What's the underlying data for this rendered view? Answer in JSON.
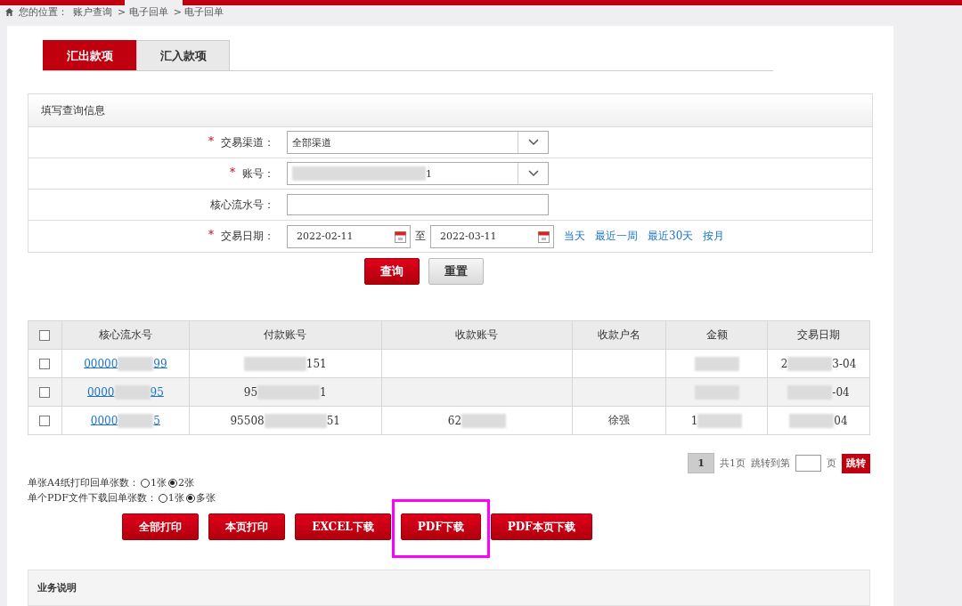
{
  "breadcrumb": {
    "label": "您的位置：",
    "path": [
      "账户查询",
      "> 电子回单",
      "> 电子回单"
    ]
  },
  "tabs": [
    {
      "label": "汇出款项",
      "selected": true
    },
    {
      "label": "汇入款项",
      "selected": false
    }
  ],
  "form": {
    "title": "填写查询信息",
    "fields": [
      {
        "kind": "select",
        "label": "交易渠道：",
        "marker": "*",
        "redacted": false,
        "value": "全部渠道"
      },
      {
        "kind": "select",
        "label": "账号：",
        "marker": "*",
        "redacted": true,
        "value": "1"
      },
      {
        "kind": "text",
        "label": "核心流水号："
      },
      {
        "kind": "daterange",
        "label": "交易日期：",
        "marker": "*",
        "from": "2022-02-11",
        "to_label": "至",
        "to": "2022-03-11",
        "shortcuts": [
          "当天",
          "最近一周",
          "最近30天",
          "按月"
        ]
      }
    ],
    "buttons": [
      {
        "label": "查询",
        "primary": true
      },
      {
        "label": "重置",
        "primary": false
      }
    ]
  },
  "table": {
    "header_checked": false,
    "columns": [
      "核心流水号",
      "付款账号",
      "收款账号",
      "收款户名",
      "金额",
      "交易日期"
    ],
    "rows": [
      {
        "checked": false,
        "cells": [
          {
            "before": "00000",
            "after": "99",
            "redacted": true
          },
          {
            "after": "151",
            "redacted": true
          },
          {
            "redacted": false
          },
          {
            "redacted": false
          },
          {
            "redacted": true
          },
          {
            "before": "2",
            "after": "3-04",
            "redacted": true
          }
        ]
      },
      {
        "checked": false,
        "cells": [
          {
            "before": "0000",
            "after": "95",
            "redacted": true
          },
          {
            "before": "95",
            "after": "1",
            "redacted": true
          },
          {
            "redacted": false
          },
          {
            "redacted": false
          },
          {
            "redacted": true
          },
          {
            "after": "-04",
            "redacted": true
          }
        ]
      },
      {
        "checked": false,
        "cells": [
          {
            "before": "0000",
            "after": "5",
            "redacted": true
          },
          {
            "before": "95508",
            "after": "51",
            "redacted": true
          },
          {
            "before": "62",
            "redacted": true
          },
          {
            "before": "徐强",
            "redacted": false
          },
          {
            "before": "1",
            "redacted": true
          },
          {
            "after": "04",
            "redacted": true
          }
        ]
      }
    ]
  },
  "pagination": {
    "page": "1",
    "total": "共1页",
    "jump_label": "跳转到第",
    "page_unit": "页",
    "jump_button": "跳转"
  },
  "options": [
    {
      "label": "单张A4纸打印回单张数：",
      "choices": [
        {
          "label": "1张",
          "selected": false
        },
        {
          "label": "2张",
          "selected": true
        }
      ]
    },
    {
      "label": "单个PDF文件下载回单张数：",
      "choices": [
        {
          "label": "1张",
          "selected": false
        },
        {
          "label": "多张",
          "selected": true
        }
      ]
    }
  ],
  "actions": [
    {
      "label": "全部打印",
      "highlighted": false
    },
    {
      "label": "本页打印",
      "highlighted": false
    },
    {
      "label": "EXCEL下载",
      "highlighted": false
    },
    {
      "label": "PDF下载",
      "highlighted": true
    },
    {
      "label": "PDF本页下载",
      "highlighted": false
    }
  ],
  "info": {
    "title": "业务说明"
  }
}
